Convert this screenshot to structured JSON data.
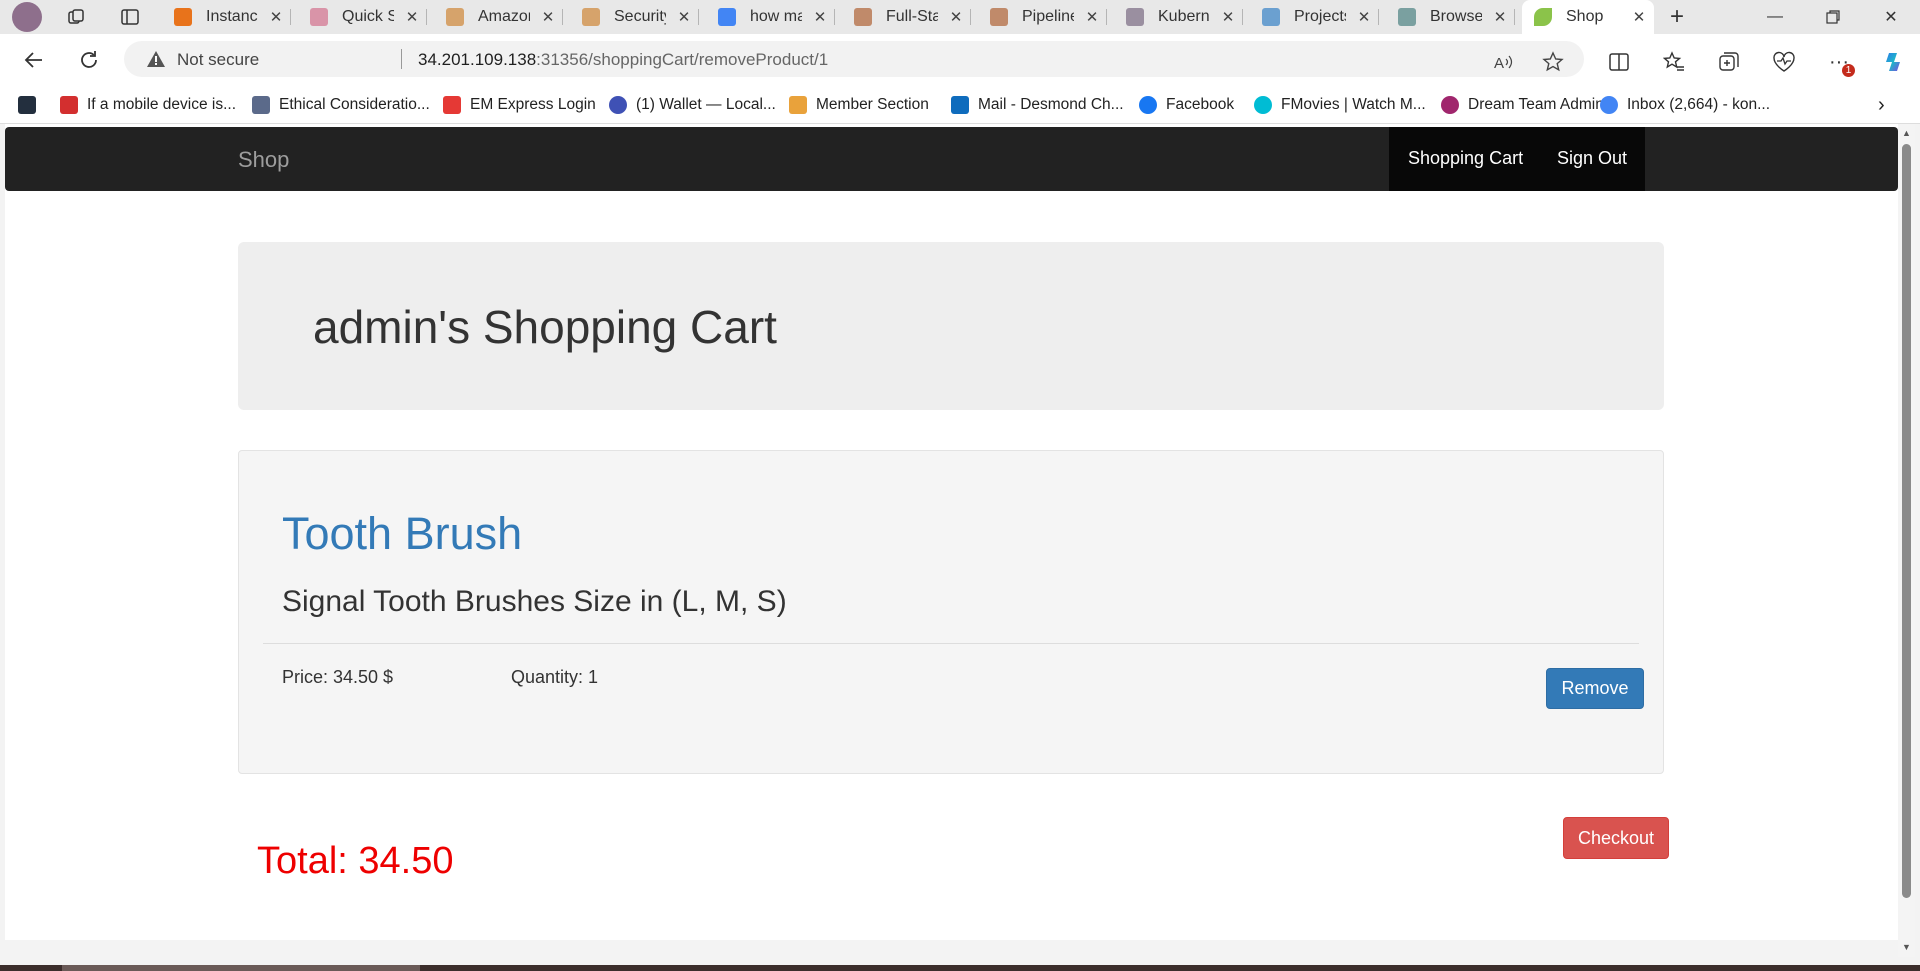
{
  "browser": {
    "tabs": [
      {
        "label": "Instance",
        "color": "#e8731b",
        "active": false
      },
      {
        "label": "Quick Se",
        "color": "#d994a8",
        "active": false
      },
      {
        "label": "Amazon",
        "color": "#d6a36b",
        "active": false
      },
      {
        "label": "Security",
        "color": "#d6a36b",
        "active": false
      },
      {
        "label": "how ma",
        "color": "#4285f4",
        "active": false
      },
      {
        "label": "Full-Stac",
        "color": "#c08a6a",
        "active": false
      },
      {
        "label": "Pipeline",
        "color": "#c08a6a",
        "active": false
      },
      {
        "label": "Kuberne",
        "color": "#9a8fa0",
        "active": false
      },
      {
        "label": "Projects",
        "color": "#6ba0d0",
        "active": false
      },
      {
        "label": "Browse",
        "color": "#7aa0a0",
        "active": false
      },
      {
        "label": "Shop",
        "color": "#8bc34a",
        "active": true
      }
    ],
    "address": {
      "security_label": "Not secure",
      "url_host": "34.201.109.138",
      "url_rest": ":31356/shoppingCart/removeProduct/1"
    },
    "notification_count": "1",
    "bookmarks": [
      {
        "label": "",
        "color": "#232f3e"
      },
      {
        "label": "If a mobile device is...",
        "color": "#d32f2f"
      },
      {
        "label": "Ethical Consideratio...",
        "color": "#5b6a8a"
      },
      {
        "label": "EM Express Login",
        "color": "#e53935"
      },
      {
        "label": "(1) Wallet — Local...",
        "color": "#3f51b5"
      },
      {
        "label": "Member Section",
        "color": "#e9a23b"
      },
      {
        "label": "Mail - Desmond Ch...",
        "color": "#0f6cbd"
      },
      {
        "label": "Facebook",
        "color": "#1877f2"
      },
      {
        "label": "FMovies | Watch M...",
        "color": "#00bcd4"
      },
      {
        "label": "Dream Team Admin...",
        "color": "#a0266d"
      },
      {
        "label": "Inbox (2,664) - kon...",
        "color": "#4285f4"
      }
    ]
  },
  "site": {
    "brand": "Shop",
    "nav": {
      "cart": "Shopping Cart",
      "signout": "Sign Out"
    },
    "cart_title": "admin's Shopping Cart",
    "items": [
      {
        "name": "Tooth Brush",
        "description": "Signal Tooth Brushes Size in (L, M, S)",
        "price": "Price: 34.50 $",
        "quantity": "Quantity: 1",
        "remove_label": "Remove"
      }
    ],
    "total": "Total: 34.50",
    "checkout_label": "Checkout"
  },
  "colors": {
    "link": "#337ab7",
    "remove": "#337ab7",
    "checkout": "#d9534f",
    "total": "#ee0000",
    "navbar": "#222222"
  }
}
